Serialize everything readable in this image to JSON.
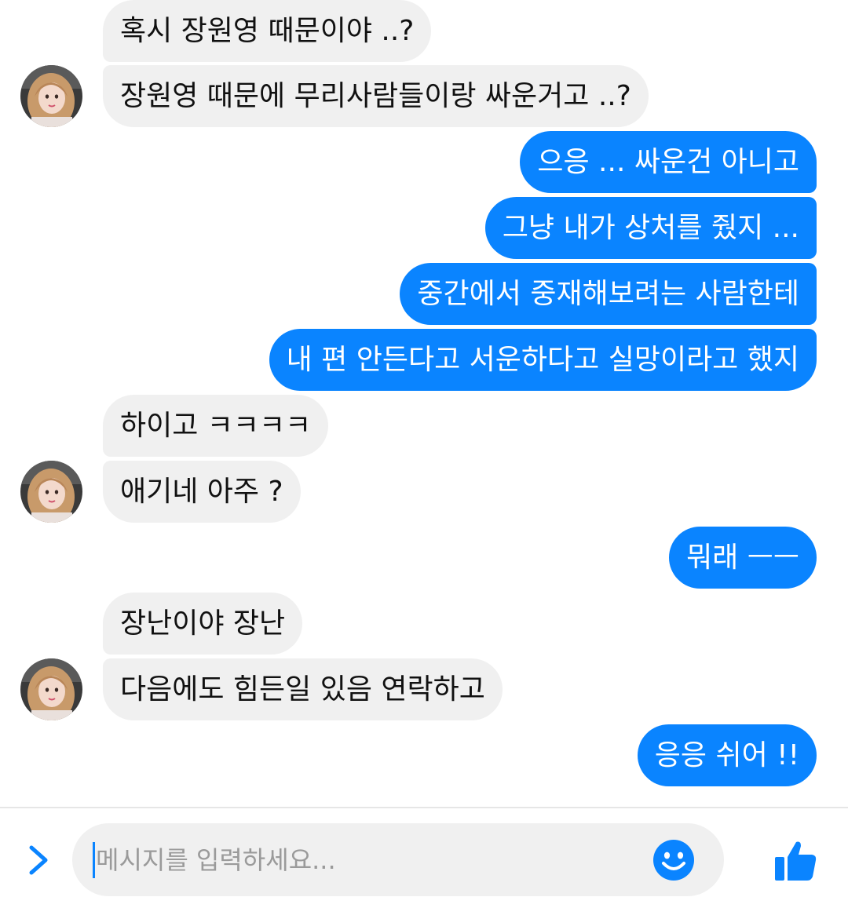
{
  "colors": {
    "accent": "#0a84ff",
    "incoming_bubble": "#f0f0f0",
    "incoming_text": "#111111",
    "outgoing_text": "#ffffff"
  },
  "messages": [
    {
      "direction": "in",
      "text": "혹시 장원영 때문이야 ..?"
    },
    {
      "direction": "in",
      "text": "장원영 때문에 무리사람들이랑 싸운거고 ..?"
    },
    {
      "direction": "out",
      "text": "으응 ... 싸운건 아니고"
    },
    {
      "direction": "out",
      "text": "그냥 내가 상처를 줬지 ..."
    },
    {
      "direction": "out",
      "text": "중간에서 중재해보려는 사람한테"
    },
    {
      "direction": "out",
      "text": "내 편 안든다고 서운하다고 실망이라고 했지"
    },
    {
      "direction": "in",
      "text": "하이고 ㅋㅋㅋㅋ"
    },
    {
      "direction": "in",
      "text": "애기네 아주 ?"
    },
    {
      "direction": "out",
      "text": "뭐래 ㅡㅡ"
    },
    {
      "direction": "in",
      "text": "장난이야 장난"
    },
    {
      "direction": "in",
      "text": "다음에도 힘든일 있음 연락하고"
    },
    {
      "direction": "out",
      "text": "응응 쉬어 !!"
    }
  ],
  "composer": {
    "placeholder": "메시지를 입력하세요...",
    "value": "",
    "expand_icon": "chevron-right-icon",
    "emoji_icon": "smiley-icon",
    "like_icon": "thumbs-up-icon"
  }
}
